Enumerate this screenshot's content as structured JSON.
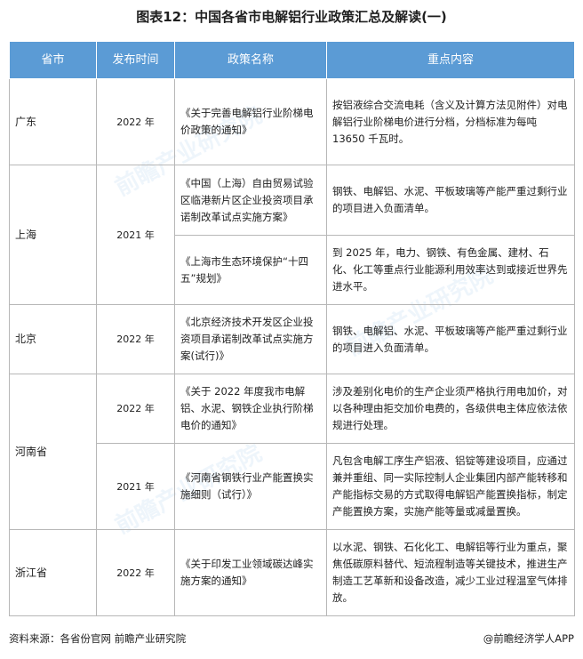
{
  "title": "图表12：中国各省市电解铝行业政策汇总及解读(一)",
  "headers": [
    "省市",
    "发布时间",
    "政策名称",
    "重点内容"
  ],
  "rows": {
    "r0": {
      "province": "广东",
      "year": "2022 年",
      "name": "《关于完善电解铝行业阶梯电价政策的通知》",
      "content": "按铝液综合交流电耗（含义及计算方法见附件）对电解铝行业阶梯电价进行分档，分档标准为每吨 13650 千瓦时。"
    },
    "r1": {
      "province": "上海",
      "year": "2021 年",
      "name": "《中国（上海）自由贸易试验区临港新片区企业投资项目承诺制改革试点实施方案》",
      "content": "钢铁、电解铝、水泥、平板玻璃等产能严重过剩行业的项目进入负面清单。"
    },
    "r2": {
      "name": "《上海市生态环境保护“十四五”规划》",
      "content": "到 2025 年，电力、钢铁、有色金属、建材、石化、化工等重点行业能源利用效率达到或接近世界先进水平。"
    },
    "r3": {
      "province": "北京",
      "year": "2022 年",
      "name": "《北京经济技术开发区企业投资项目承诺制改革试点实施方案(试行)》",
      "content": "钢铁、电解铝、水泥、平板玻璃等产能严重过剩行业的项目进入负面清单。"
    },
    "r4": {
      "province": "河南省",
      "year": "2022 年",
      "name": "《关于 2022 年度我市电解铝、水泥、钢铁企业执行阶梯电价的通知》",
      "content": "涉及差别化电价的生产企业须严格执行用电加价，对以各种理由拒交加价电费的，各级供电主体应依法依规进行处理。"
    },
    "r5": {
      "year": "2021 年",
      "name": "《河南省钢铁行业产能置换实施细则（试行）》",
      "content": "凡包含电解工序生产铝液、铝锭等建设项目，应通过兼并重组、同一实际控制人企业集团内部产能转移和产能指标交易的方式取得电解铝产能置换指标，制定产能置换方案，实施产能等量或减量置换。"
    },
    "r6": {
      "province": "浙江省",
      "year": "2022 年",
      "name": "《关于印发工业领域碳达峰实施方案的通知》",
      "content": "以水泥、钢铁、石化化工、电解铝等行业为重点，聚焦低碳原料替代、短流程制造等关键技术，推进生产制造工艺革新和设备改造，减少工业过程温室气体排放。"
    }
  },
  "footer": {
    "source": "资料来源：各省份官网 前瞻产业研究院",
    "brand": "@前瞻经济学人APP"
  },
  "colors": {
    "header_bg": "#5b9bd5",
    "header_text": "#ffffff",
    "border": "#b7b7b7"
  }
}
